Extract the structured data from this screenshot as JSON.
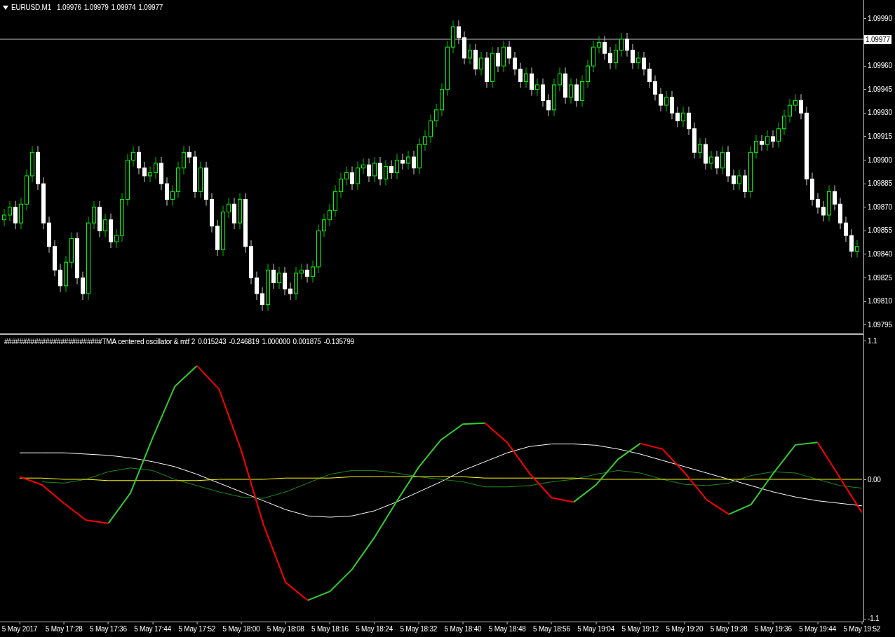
{
  "price_chart": {
    "symbol": "EURUSD,M1",
    "quotes": [
      "1.09976",
      "1.09979",
      "1.09974",
      "1.09977"
    ],
    "chart_data": {
      "type": "candlestick",
      "ylim": [
        1.0979,
        1.10002
      ],
      "ref_lines": [
        {
          "axis": "y",
          "value": 1.09977,
          "label": "1.09977"
        }
      ],
      "yticks": [
        {
          "value": 1.0999,
          "label": "1.09990"
        },
        {
          "value": 1.0996,
          "label": "1.09960"
        },
        {
          "value": 1.09945,
          "label": "1.09945"
        },
        {
          "value": 1.0993,
          "label": "1.09930"
        },
        {
          "value": 1.09915,
          "label": "1.09915"
        },
        {
          "value": 1.099,
          "label": "1.09900"
        },
        {
          "value": 1.09885,
          "label": "1.09885"
        },
        {
          "value": 1.0987,
          "label": "1.09870"
        },
        {
          "value": 1.09855,
          "label": "1.09855"
        },
        {
          "value": 1.0984,
          "label": "1.09840"
        },
        {
          "value": 1.09825,
          "label": "1.09825"
        },
        {
          "value": 1.0981,
          "label": "1.09810"
        },
        {
          "value": 1.09795,
          "label": "1.09795"
        }
      ],
      "categories": [
        null,
        null,
        null,
        null,
        null,
        null,
        null,
        null,
        null,
        null,
        null,
        null,
        null,
        null,
        null,
        null,
        null,
        null,
        null,
        null,
        null,
        null,
        null,
        null,
        null,
        null,
        null,
        null,
        null,
        null,
        null,
        null,
        null,
        null,
        null,
        null,
        null,
        null,
        null,
        null,
        null,
        null,
        null,
        null,
        null,
        null,
        null,
        null,
        null,
        null,
        null,
        null,
        null,
        null,
        null,
        null,
        null,
        null,
        null,
        null,
        null,
        null,
        null,
        null,
        null,
        null,
        null,
        null,
        null,
        null,
        null,
        null,
        null,
        null,
        null,
        null,
        null,
        null,
        null,
        null,
        null,
        null,
        null,
        null,
        null,
        null,
        null,
        null,
        null,
        null,
        null,
        null,
        null,
        null,
        null,
        null,
        null,
        null,
        null,
        null,
        null,
        null,
        null,
        null,
        null,
        null,
        null,
        null,
        null,
        null,
        null,
        null,
        null,
        null,
        null,
        null,
        null,
        null,
        null,
        null,
        null,
        null,
        null,
        null,
        null,
        null,
        null,
        null,
        null,
        null,
        null,
        null,
        null,
        null,
        null,
        null,
        null,
        null,
        null,
        null,
        null,
        null,
        null,
        null,
        null,
        null,
        null,
        null,
        null,
        null,
        null,
        null,
        null
      ],
      "ohlc": [
        [
          1.09862,
          1.09869,
          1.09858,
          1.09865
        ],
        [
          1.09865,
          1.09874,
          1.09861,
          1.0987
        ],
        [
          1.0987,
          1.09874,
          1.09856,
          1.0986
        ],
        [
          1.0986,
          1.09876,
          1.09856,
          1.09872
        ],
        [
          1.09872,
          1.09894,
          1.09868,
          1.0989
        ],
        [
          1.0989,
          1.09909,
          1.09886,
          1.09905
        ],
        [
          1.09905,
          1.09909,
          1.09881,
          1.09885
        ],
        [
          1.09885,
          1.09889,
          1.09856,
          1.0986
        ],
        [
          1.0986,
          1.09864,
          1.09841,
          1.09845
        ],
        [
          1.09845,
          1.09849,
          1.09826,
          1.0983
        ],
        [
          1.0983,
          1.09834,
          1.09816,
          1.0982
        ],
        [
          1.0982,
          1.09839,
          1.09816,
          1.09835
        ],
        [
          1.09835,
          1.09854,
          1.09831,
          1.0985
        ],
        [
          1.0985,
          1.09854,
          1.09821,
          1.09825
        ],
        [
          1.09825,
          1.09829,
          1.09811,
          1.09815
        ],
        [
          1.09815,
          1.09864,
          1.09811,
          1.0986
        ],
        [
          1.0986,
          1.09874,
          1.09856,
          1.0987
        ],
        [
          1.0987,
          1.09874,
          1.09851,
          1.09855
        ],
        [
          1.09855,
          1.09866,
          1.09851,
          1.09862
        ],
        [
          1.09862,
          1.09866,
          1.09844,
          1.09848
        ],
        [
          1.09848,
          1.09856,
          1.09844,
          1.09852
        ],
        [
          1.09852,
          1.09879,
          1.09848,
          1.09875
        ],
        [
          1.09875,
          1.09904,
          1.09871,
          1.099
        ],
        [
          1.099,
          1.09909,
          1.09896,
          1.09905
        ],
        [
          1.09905,
          1.09909,
          1.09891,
          1.09895
        ],
        [
          1.09895,
          1.09899,
          1.09886,
          1.0989
        ],
        [
          1.0989,
          1.09896,
          1.09886,
          1.09892
        ],
        [
          1.09892,
          1.09902,
          1.09888,
          1.09898
        ],
        [
          1.09898,
          1.09902,
          1.09881,
          1.09885
        ],
        [
          1.09885,
          1.09889,
          1.09871,
          1.09875
        ],
        [
          1.09875,
          1.09884,
          1.09871,
          1.0988
        ],
        [
          1.0988,
          1.09899,
          1.09876,
          1.09895
        ],
        [
          1.09895,
          1.09909,
          1.09891,
          1.09905
        ],
        [
          1.09905,
          1.09909,
          1.09898,
          1.09902
        ],
        [
          1.09902,
          1.09906,
          1.09876,
          1.0988
        ],
        [
          1.0988,
          1.09899,
          1.09876,
          1.09895
        ],
        [
          1.09895,
          1.09899,
          1.09871,
          1.09875
        ],
        [
          1.09875,
          1.09879,
          1.09854,
          1.09858
        ],
        [
          1.09858,
          1.09862,
          1.09839,
          1.09843
        ],
        [
          1.09843,
          1.09871,
          1.09839,
          1.09867
        ],
        [
          1.09867,
          1.09876,
          1.09863,
          1.09872
        ],
        [
          1.09872,
          1.09876,
          1.09856,
          1.0986
        ],
        [
          1.0986,
          1.09879,
          1.09856,
          1.09875
        ],
        [
          1.09875,
          1.09879,
          1.09841,
          1.09845
        ],
        [
          1.09845,
          1.09849,
          1.09821,
          1.09825
        ],
        [
          1.09825,
          1.09829,
          1.09811,
          1.09815
        ],
        [
          1.09815,
          1.09819,
          1.09804,
          1.09808
        ],
        [
          1.09808,
          1.09834,
          1.09804,
          1.0983
        ],
        [
          1.0983,
          1.09834,
          1.09818,
          1.09822
        ],
        [
          1.09822,
          1.09832,
          1.09818,
          1.09828
        ],
        [
          1.09828,
          1.09832,
          1.09814,
          1.09818
        ],
        [
          1.09818,
          1.09822,
          1.09811,
          1.09815
        ],
        [
          1.09815,
          1.09832,
          1.09811,
          1.09828
        ],
        [
          1.09828,
          1.09834,
          1.09824,
          1.0983
        ],
        [
          1.0983,
          1.09834,
          1.09822,
          1.09826
        ],
        [
          1.09826,
          1.09836,
          1.09822,
          1.09832
        ],
        [
          1.09832,
          1.09859,
          1.09828,
          1.09855
        ],
        [
          1.09855,
          1.09866,
          1.09851,
          1.09862
        ],
        [
          1.09862,
          1.09872,
          1.09858,
          1.09868
        ],
        [
          1.09868,
          1.09884,
          1.09864,
          1.0988
        ],
        [
          1.0988,
          1.09892,
          1.09876,
          1.09888
        ],
        [
          1.09888,
          1.09896,
          1.09884,
          1.09892
        ],
        [
          1.09892,
          1.09896,
          1.09881,
          1.09885
        ],
        [
          1.09885,
          1.09899,
          1.09881,
          1.09895
        ],
        [
          1.09895,
          1.09901,
          1.09891,
          1.09897
        ],
        [
          1.09897,
          1.09901,
          1.09886,
          1.0989
        ],
        [
          1.0989,
          1.09902,
          1.09886,
          1.09898
        ],
        [
          1.09898,
          1.09902,
          1.09884,
          1.09888
        ],
        [
          1.09888,
          1.099,
          1.09884,
          1.09896
        ],
        [
          1.09896,
          1.099,
          1.09888,
          1.09892
        ],
        [
          1.09892,
          1.09904,
          1.09888,
          1.099
        ],
        [
          1.099,
          1.09904,
          1.09894,
          1.09898
        ],
        [
          1.09898,
          1.09906,
          1.09894,
          1.09902
        ],
        [
          1.09902,
          1.09906,
          1.09891,
          1.09895
        ],
        [
          1.09895,
          1.09914,
          1.09891,
          1.0991
        ],
        [
          1.0991,
          1.09919,
          1.09906,
          1.09915
        ],
        [
          1.09915,
          1.09929,
          1.09911,
          1.09925
        ],
        [
          1.09925,
          1.09936,
          1.09921,
          1.09932
        ],
        [
          1.09932,
          1.09949,
          1.09928,
          1.09945
        ],
        [
          1.09945,
          1.09976,
          1.09941,
          1.09972
        ],
        [
          1.09972,
          1.09989,
          1.09968,
          1.09985
        ],
        [
          1.09985,
          1.09989,
          1.09974,
          1.09978
        ],
        [
          1.09978,
          1.09982,
          1.09961,
          1.09965
        ],
        [
          1.09965,
          1.09974,
          1.09961,
          1.0997
        ],
        [
          1.0997,
          1.09974,
          1.09954,
          1.09958
        ],
        [
          1.09958,
          1.09969,
          1.09954,
          1.09965
        ],
        [
          1.09965,
          1.09969,
          1.09946,
          1.0995
        ],
        [
          1.0995,
          1.09972,
          1.09946,
          1.09968
        ],
        [
          1.09968,
          1.09972,
          1.09956,
          1.0996
        ],
        [
          1.0996,
          1.09976,
          1.09956,
          1.09972
        ],
        [
          1.09972,
          1.09976,
          1.09961,
          1.09965
        ],
        [
          1.09965,
          1.09969,
          1.09954,
          1.09958
        ],
        [
          1.09958,
          1.09962,
          1.09946,
          1.0995
        ],
        [
          1.0995,
          1.09959,
          1.09946,
          1.09955
        ],
        [
          1.09955,
          1.09959,
          1.09941,
          1.09945
        ],
        [
          1.09945,
          1.09952,
          1.09941,
          1.09948
        ],
        [
          1.09948,
          1.09952,
          1.09934,
          1.09938
        ],
        [
          1.09938,
          1.09942,
          1.09928,
          1.09932
        ],
        [
          1.09932,
          1.09952,
          1.09928,
          1.09948
        ],
        [
          1.09948,
          1.09959,
          1.09944,
          1.09955
        ],
        [
          1.09955,
          1.09959,
          1.09936,
          1.0994
        ],
        [
          1.0994,
          1.09952,
          1.09936,
          1.09948
        ],
        [
          1.09948,
          1.09952,
          1.09934,
          1.09938
        ],
        [
          1.09938,
          1.09954,
          1.09934,
          1.0995
        ],
        [
          1.0995,
          1.09964,
          1.09946,
          1.0996
        ],
        [
          1.0996,
          1.09976,
          1.09956,
          1.09972
        ],
        [
          1.09972,
          1.09979,
          1.09968,
          1.09975
        ],
        [
          1.09975,
          1.09979,
          1.09964,
          1.09968
        ],
        [
          1.09968,
          1.09972,
          1.09958,
          1.09962
        ],
        [
          1.09962,
          1.09974,
          1.09958,
          1.0997
        ],
        [
          1.0997,
          1.09981,
          1.09966,
          1.09977
        ],
        [
          1.09977,
          1.09981,
          1.09966,
          1.0997
        ],
        [
          1.0997,
          1.09974,
          1.09958,
          1.09962
        ],
        [
          1.09962,
          1.09969,
          1.09958,
          1.09965
        ],
        [
          1.09965,
          1.09969,
          1.09954,
          1.09958
        ],
        [
          1.09958,
          1.09962,
          1.09946,
          1.0995
        ],
        [
          1.0995,
          1.09954,
          1.09938,
          1.09942
        ],
        [
          1.09942,
          1.09946,
          1.09931,
          1.09935
        ],
        [
          1.09935,
          1.09944,
          1.09931,
          1.0994
        ],
        [
          1.0994,
          1.09944,
          1.09926,
          1.0993
        ],
        [
          1.0993,
          1.09934,
          1.09921,
          1.09925
        ],
        [
          1.09925,
          1.09934,
          1.09921,
          1.0993
        ],
        [
          1.0993,
          1.09934,
          1.09916,
          1.0992
        ],
        [
          1.0992,
          1.09924,
          1.09901,
          1.09905
        ],
        [
          1.09905,
          1.09914,
          1.09901,
          1.0991
        ],
        [
          1.0991,
          1.09914,
          1.09894,
          1.09898
        ],
        [
          1.09898,
          1.09906,
          1.09894,
          1.09902
        ],
        [
          1.09902,
          1.09906,
          1.09891,
          1.09895
        ],
        [
          1.09895,
          1.09909,
          1.09891,
          1.09905
        ],
        [
          1.09905,
          1.09909,
          1.09886,
          1.0989
        ],
        [
          1.0989,
          1.09894,
          1.09881,
          1.09885
        ],
        [
          1.09885,
          1.09894,
          1.09881,
          1.0989
        ],
        [
          1.0989,
          1.09894,
          1.09876,
          1.0988
        ],
        [
          1.0988,
          1.09909,
          1.09876,
          1.09905
        ],
        [
          1.09905,
          1.09916,
          1.09901,
          1.09912
        ],
        [
          1.09912,
          1.09916,
          1.09906,
          1.0991
        ],
        [
          1.0991,
          1.09919,
          1.09906,
          1.09915
        ],
        [
          1.09915,
          1.09919,
          1.09908,
          1.09912
        ],
        [
          1.09912,
          1.09924,
          1.09908,
          1.0992
        ],
        [
          1.0992,
          1.09932,
          1.09916,
          1.09928
        ],
        [
          1.09928,
          1.09939,
          1.09924,
          1.09935
        ],
        [
          1.09935,
          1.09942,
          1.09931,
          1.09938
        ],
        [
          1.09938,
          1.09942,
          1.09926,
          1.0993
        ],
        [
          1.0993,
          1.09934,
          1.09884,
          1.09888
        ],
        [
          1.09888,
          1.09892,
          1.09871,
          1.09875
        ],
        [
          1.09875,
          1.09879,
          1.09866,
          1.0987
        ],
        [
          1.0987,
          1.09874,
          1.09861,
          1.09865
        ],
        [
          1.09865,
          1.09884,
          1.09861,
          1.0988
        ],
        [
          1.0988,
          1.09884,
          1.09868,
          1.09872
        ],
        [
          1.09872,
          1.09876,
          1.09856,
          1.0986
        ],
        [
          1.0986,
          1.09864,
          1.09848,
          1.09852
        ],
        [
          1.09852,
          1.09856,
          1.09838,
          1.09842
        ],
        [
          1.09842,
          1.09849,
          1.09838,
          1.09845
        ]
      ]
    }
  },
  "indicator": {
    "title": "##########################TMA centered oscillator & mtf 2",
    "values": [
      "0.015243",
      "-0.246819",
      "1.000000",
      "0.001875",
      "-0.135799"
    ],
    "chart_data": {
      "type": "line",
      "categories": [
        "5 May 2017",
        null,
        "5 May 17:28",
        null,
        "5 May 17:36",
        null,
        "5 May 17:44",
        null,
        "5 May 17:52",
        null,
        "5 May 18:00",
        null,
        "5 May 18:08",
        null,
        "5 May 18:16",
        null,
        "5 May 18:24",
        null,
        "5 May 18:32",
        null,
        "5 May 18:40",
        null,
        "5 May 18:48",
        null,
        "5 May 18:56",
        null,
        "5 May 19:04",
        null,
        "5 May 19:12",
        null,
        "5 May 19:20",
        null,
        "5 May 19:28",
        null,
        "5 May 19:36",
        null,
        "5 May 19:44",
        null,
        "5 May 19:52"
      ],
      "ylim": [
        -1.133,
        1.144
      ],
      "yticks": [
        1.1,
        {
          "value": 0,
          "label": "0.00"
        },
        -1.1
      ],
      "series": [
        {
          "color": "#ffffff",
          "values": [
            0.21,
            0.21,
            0.21,
            0.2,
            0.19,
            0.17,
            0.14,
            0.1,
            0.04,
            -0.03,
            -0.1,
            -0.17,
            -0.24,
            -0.29,
            -0.3,
            -0.29,
            -0.25,
            -0.18,
            -0.1,
            -0.02,
            0.07,
            0.14,
            0.21,
            0.26,
            0.28,
            0.28,
            0.27,
            0.24,
            0.2,
            0.15,
            0.1,
            0.05,
            0.0,
            -0.05,
            -0.1,
            -0.14,
            -0.17,
            -0.19,
            -0.21
          ]
        },
        {
          "color": "#1e8c1e",
          "values": [
            null,
            -0.02,
            -0.03,
            0.0,
            0.06,
            0.09,
            0.07,
            0.0,
            -0.05,
            -0.1,
            -0.14,
            -0.15,
            -0.1,
            -0.03,
            0.04,
            0.07,
            0.07,
            0.05,
            0.02,
            0.0,
            -0.02,
            -0.06,
            -0.06,
            -0.05,
            -0.02,
            0.0,
            0.04,
            0.07,
            0.05,
            0.0,
            -0.04,
            -0.05,
            -0.03,
            0.03,
            0.06,
            0.05,
            0.0,
            -0.05,
            -0.07
          ]
        },
        {
          "color": "#ffff00",
          "values": [
            0.01,
            0.01,
            0.0,
            0.0,
            -0.01,
            -0.01,
            -0.01,
            -0.01,
            -0.01,
            0.0,
            0.0,
            0.0,
            0.01,
            0.01,
            0.01,
            0.02,
            0.02,
            0.02,
            0.02,
            0.02,
            0.02,
            0.01,
            0.01,
            0.01,
            0.01,
            0.01,
            0.0,
            0.0,
            0.0,
            0.0,
            0.0,
            0.0,
            0.0,
            0.0,
            0.0,
            0.0,
            0.0,
            0.0,
            0.0
          ]
        },
        {
          "color": "#32cd32",
          "values": [
            null,
            null,
            null,
            null,
            -0.349,
            -0.109,
            0.328,
            0.736,
            0.9,
            null,
            null,
            null,
            null,
            -0.959,
            -0.888,
            -0.713,
            -0.463,
            -0.178,
            0.095,
            0.311,
            0.437,
            0.446,
            null,
            null,
            null,
            -0.18,
            -0.045,
            0.159,
            0.284,
            null,
            null,
            null,
            -0.277,
            -0.199,
            0.047,
            0.273,
            0.293,
            null,
            null
          ]
        },
        {
          "color": "#ff0000",
          "values": [
            0.02,
            -0.043,
            -0.19,
            -0.324,
            -0.349,
            null,
            null,
            null,
            0.9,
            0.714,
            0.228,
            -0.359,
            -0.817,
            -0.959,
            null,
            null,
            null,
            null,
            null,
            null,
            null,
            0.446,
            0.292,
            0.048,
            -0.146,
            -0.18,
            null,
            null,
            0.284,
            0.24,
            0.053,
            -0.163,
            -0.277,
            null,
            null,
            null,
            0.293,
            0.015,
            -0.263
          ]
        }
      ]
    }
  }
}
